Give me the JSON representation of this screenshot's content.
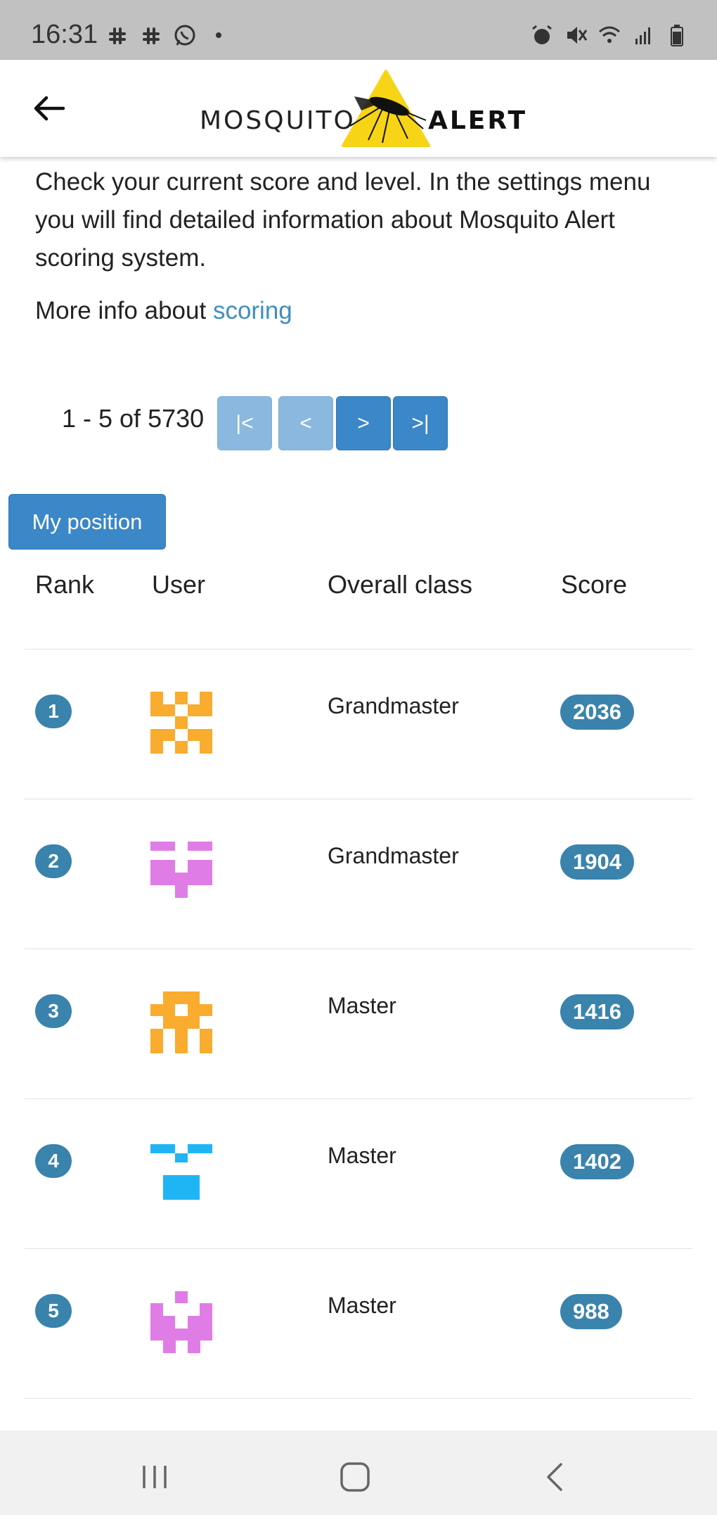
{
  "status_bar": {
    "time": "16:31",
    "left_icons": [
      "slack-icon",
      "slack-icon",
      "whatsapp-icon",
      "dot-icon"
    ],
    "right_icons": [
      "alarm-icon",
      "mute-icon",
      "wifi-icon",
      "signal-icon",
      "battery-icon"
    ]
  },
  "header": {
    "logo_word_1": "MOSQUITO",
    "logo_word_2": "ALERT",
    "back_icon": "arrow-left-icon"
  },
  "intro": {
    "text": "Check your current score and level. In the settings menu you will find detailed information about Mosquito Alert scoring system.",
    "more_info_prefix": "More info about ",
    "more_info_link": "scoring"
  },
  "pager": {
    "summary": "1 - 5 of 5730",
    "first": "|<",
    "prev": "<",
    "next": ">",
    "last": ">|"
  },
  "my_position_label": "My position",
  "table": {
    "columns": [
      "Rank",
      "User",
      "Overall class",
      "Score"
    ],
    "rows": [
      {
        "rank": "1",
        "class": "Grandmaster",
        "score": "2036",
        "avatar_color": "#f9ac2e"
      },
      {
        "rank": "2",
        "class": "Grandmaster",
        "score": "1904",
        "avatar_color": "#e07ce6"
      },
      {
        "rank": "3",
        "class": "Master",
        "score": "1416",
        "avatar_color": "#f9ac2e"
      },
      {
        "rank": "4",
        "class": "Master",
        "score": "1402",
        "avatar_color": "#1fb5f5"
      },
      {
        "rank": "5",
        "class": "Master",
        "score": "988",
        "avatar_color": "#e07ce6"
      }
    ]
  },
  "colors": {
    "accent": "#3b87c8",
    "accent_disabled": "#8ab8df",
    "badge": "#3a83ad",
    "link": "#3f8ec1",
    "logo_yellow": "#f7d416"
  }
}
